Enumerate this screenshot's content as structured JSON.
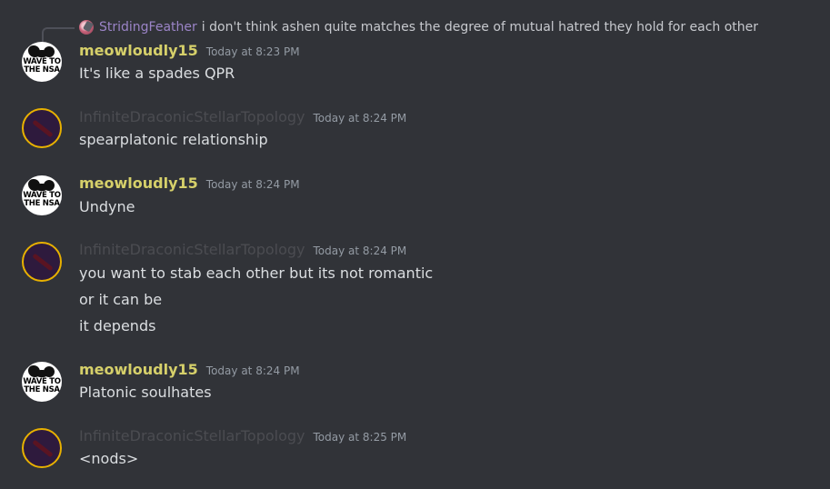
{
  "reply": {
    "username": "StridingFeather",
    "text": "i don't think ashen quite matches the degree of mutual hatred they hold for each other"
  },
  "colors": {
    "background": "#313338",
    "meow_name": "#d6d06a",
    "infinite_name": "#4b4c51",
    "reply_name": "#9b84c7",
    "message_text": "#dbdee1",
    "timestamp": "#949ba4",
    "avatar_ring": "#e8b100"
  },
  "messages": [
    {
      "username": "meowloudly15",
      "timestamp": "Today at 8:23 PM",
      "avatar": "wave-to-the-nsa-avatar",
      "avatar_text": "WAVE TO THE NSA",
      "lines": [
        "It's like a spades QPR"
      ]
    },
    {
      "username": "InfiniteDraconicStellarTopology",
      "timestamp": "Today at 8:24 PM",
      "avatar": "dragon-avatar",
      "lines": [
        "spearplatonic relationship"
      ]
    },
    {
      "username": "meowloudly15",
      "timestamp": "Today at 8:24 PM",
      "avatar": "wave-to-the-nsa-avatar",
      "avatar_text": "WAVE TO THE NSA",
      "lines": [
        "Undyne"
      ]
    },
    {
      "username": "InfiniteDraconicStellarTopology",
      "timestamp": "Today at 8:24 PM",
      "avatar": "dragon-avatar",
      "lines": [
        "you want to stab each other but its not romantic",
        "or it can be",
        "it depends"
      ]
    },
    {
      "username": "meowloudly15",
      "timestamp": "Today at 8:24 PM",
      "avatar": "wave-to-the-nsa-avatar",
      "avatar_text": "WAVE TO THE NSA",
      "lines": [
        "Platonic soulhates"
      ]
    },
    {
      "username": "InfiniteDraconicStellarTopology",
      "timestamp": "Today at 8:25 PM",
      "avatar": "dragon-avatar",
      "lines": [
        "<nods>"
      ]
    }
  ]
}
